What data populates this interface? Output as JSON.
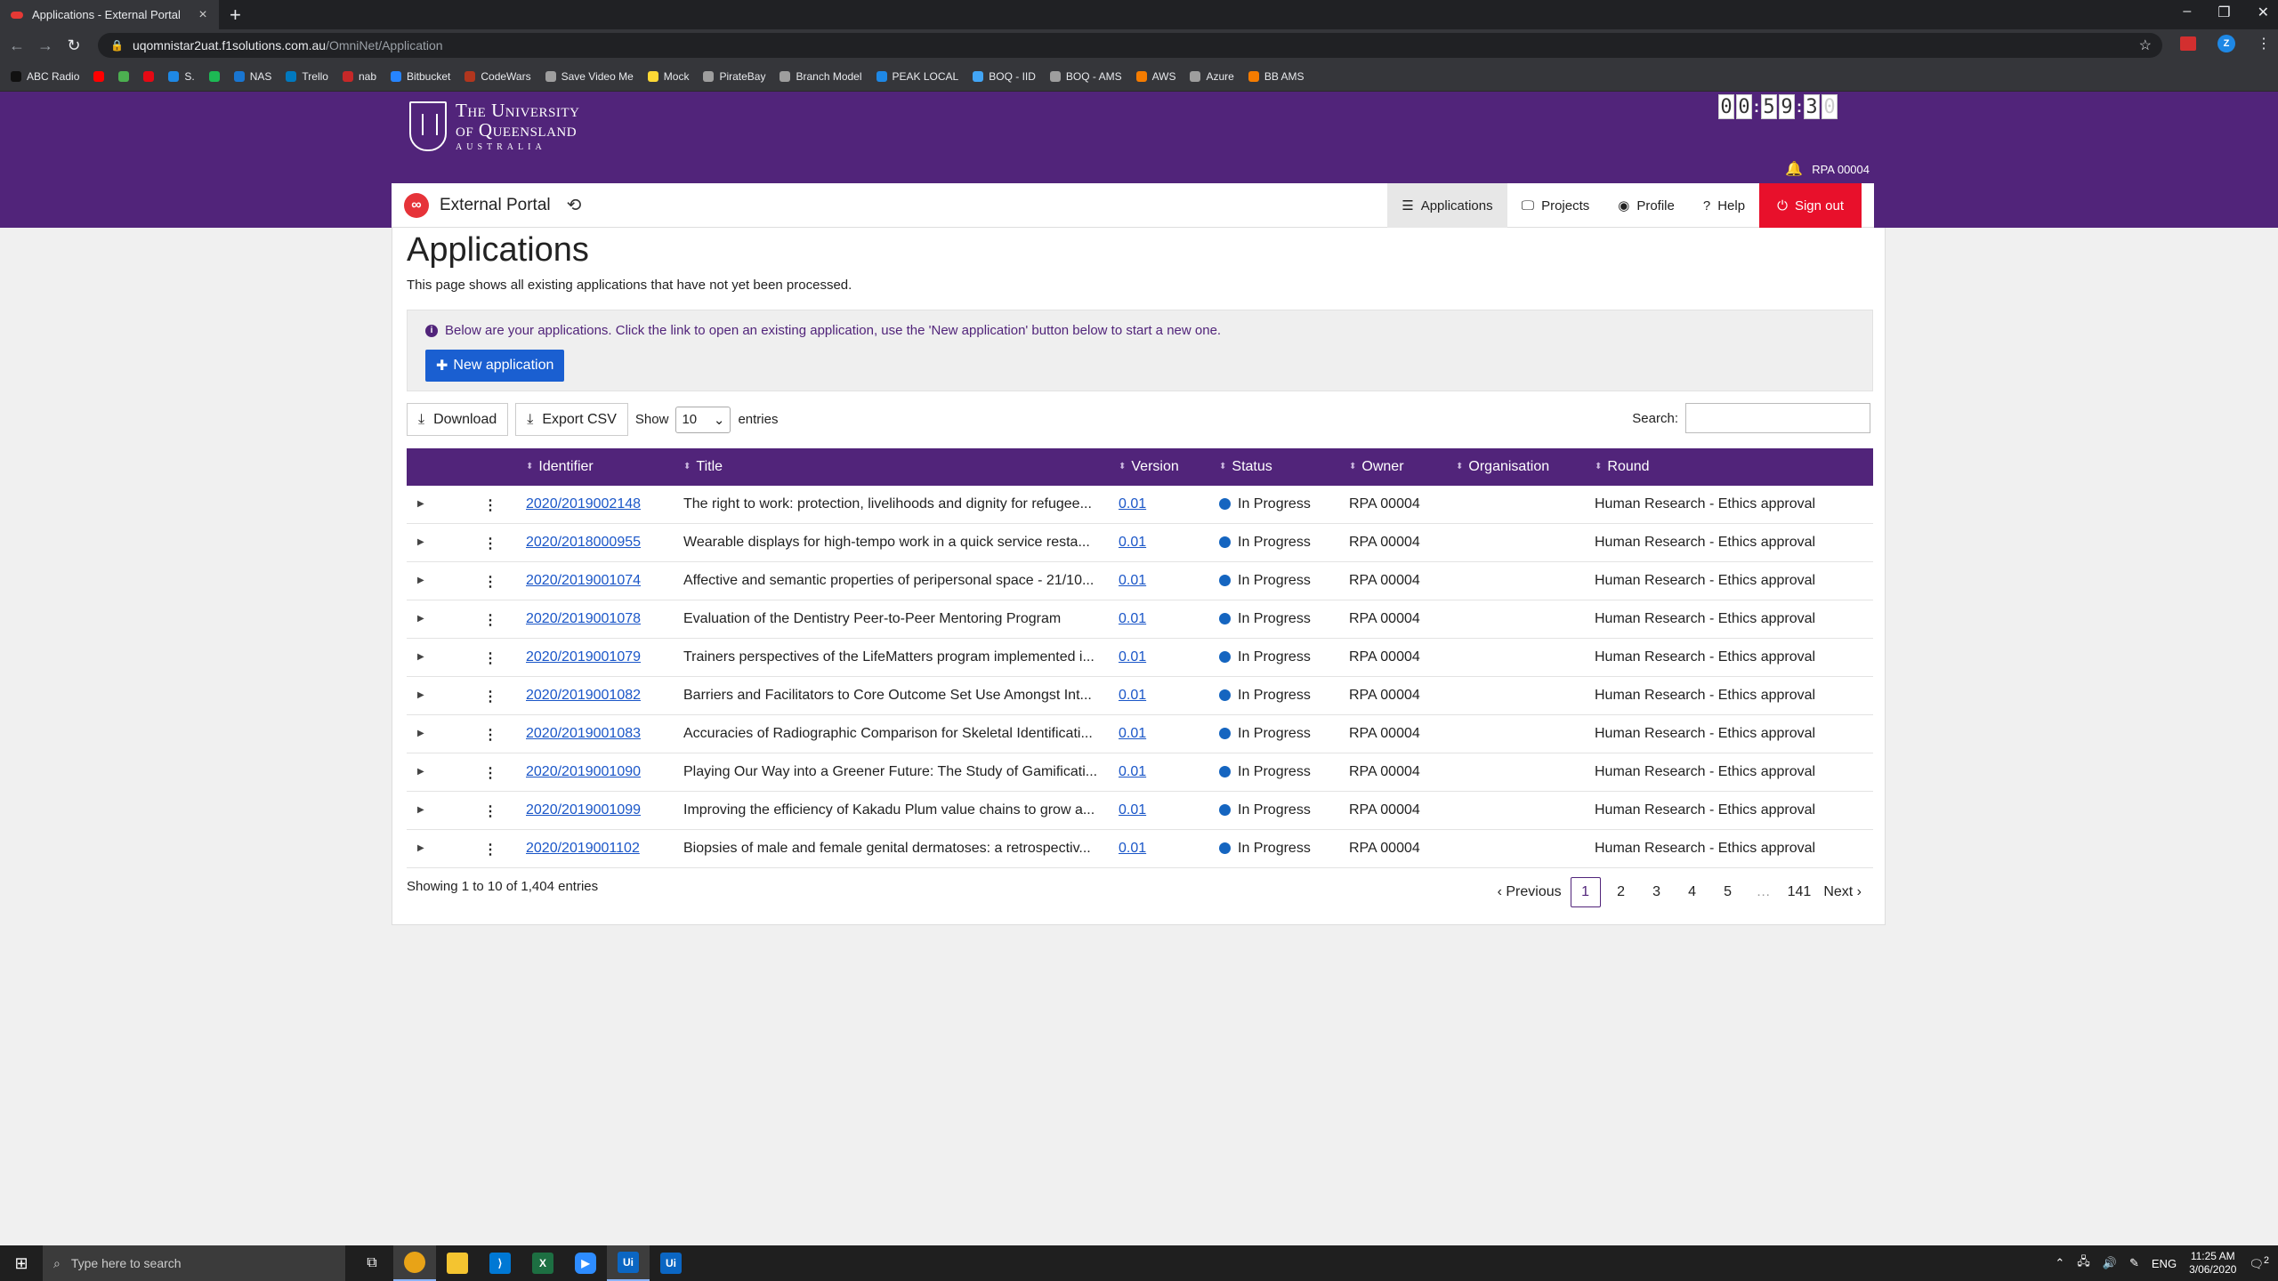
{
  "browser": {
    "tab_title": "Applications - External Portal",
    "url_domain": "uqomnistar2uat.f1solutions.com.au",
    "url_path": "/OmniNet/Application",
    "profile_initial": "Z",
    "bookmarks": [
      {
        "label": "ABC Radio",
        "color": "#111111"
      },
      {
        "label": "",
        "color": "#ff0000"
      },
      {
        "label": "",
        "color": "#4caf50"
      },
      {
        "label": "",
        "color": "#e50914"
      },
      {
        "label": "S.",
        "color": "#1e88e5"
      },
      {
        "label": "",
        "color": "#1db954"
      },
      {
        "label": "NAS",
        "color": "#1976d2"
      },
      {
        "label": "Trello",
        "color": "#0079bf"
      },
      {
        "label": "nab",
        "color": "#c62828"
      },
      {
        "label": "Bitbucket",
        "color": "#2684ff"
      },
      {
        "label": "CodeWars",
        "color": "#b1361e"
      },
      {
        "label": "Save Video Me",
        "color": "#9e9e9e"
      },
      {
        "label": "Mock",
        "color": "#fdd835"
      },
      {
        "label": "PirateBay",
        "color": "#9e9e9e"
      },
      {
        "label": "Branch Model",
        "color": "#9e9e9e"
      },
      {
        "label": "PEAK LOCAL",
        "color": "#1e88e5"
      },
      {
        "label": "BOQ - IID",
        "color": "#42a5f5"
      },
      {
        "label": "BOQ - AMS",
        "color": "#9e9e9e"
      },
      {
        "label": "AWS",
        "color": "#f57c00"
      },
      {
        "label": "Azure",
        "color": "#9e9e9e"
      },
      {
        "label": "BB AMS",
        "color": "#f57c00"
      }
    ]
  },
  "header": {
    "logo_line1": "The University",
    "logo_line2": "of Queensland",
    "logo_line3": "AUSTRALIA",
    "timer_digits": [
      "0",
      "0",
      "5",
      "9",
      "3",
      "0"
    ],
    "user": "RPA 00004",
    "brand": "External Portal",
    "nav": [
      {
        "label": "Applications",
        "icon": "list-icon"
      },
      {
        "label": "Projects",
        "icon": "monitor-icon"
      },
      {
        "label": "Profile",
        "icon": "user-circle-icon"
      },
      {
        "label": "Help",
        "icon": "question-icon"
      },
      {
        "label": "Sign out",
        "icon": "power-icon"
      }
    ]
  },
  "page": {
    "title": "Applications",
    "description": "This page shows all existing applications that have not yet been processed.",
    "info": "Below are your applications. Click the link to open an existing application, use the 'New application' button below to start a new one.",
    "new_button": "New application",
    "download": "Download",
    "export_csv": "Export CSV",
    "show_label": "Show",
    "show_value": "10",
    "entries_label": "entries",
    "search_label": "Search:",
    "search_value": ""
  },
  "table": {
    "headers": [
      "Identifier",
      "Title",
      "Version",
      "Status",
      "Owner",
      "Organisation",
      "Round"
    ],
    "rows": [
      {
        "id": "2020/2019002148",
        "title": "The right to work: protection, livelihoods and dignity for refugee...",
        "version": "0.01",
        "status": "In Progress",
        "owner": "RPA 00004",
        "org": "",
        "round": "Human Research - Ethics approval"
      },
      {
        "id": "2020/2018000955",
        "title": "Wearable displays for high-tempo work in a quick service resta...",
        "version": "0.01",
        "status": "In Progress",
        "owner": "RPA 00004",
        "org": "",
        "round": "Human Research - Ethics approval"
      },
      {
        "id": "2020/2019001074",
        "title": "Affective and semantic properties of peripersonal space - 21/10...",
        "version": "0.01",
        "status": "In Progress",
        "owner": "RPA 00004",
        "org": "",
        "round": "Human Research - Ethics approval"
      },
      {
        "id": "2020/2019001078",
        "title": "Evaluation of the Dentistry Peer-to-Peer Mentoring Program",
        "version": "0.01",
        "status": "In Progress",
        "owner": "RPA 00004",
        "org": "",
        "round": "Human Research - Ethics approval"
      },
      {
        "id": "2020/2019001079",
        "title": "Trainers perspectives of the LifeMatters program implemented i...",
        "version": "0.01",
        "status": "In Progress",
        "owner": "RPA 00004",
        "org": "",
        "round": "Human Research - Ethics approval"
      },
      {
        "id": "2020/2019001082",
        "title": "Barriers and Facilitators to Core Outcome Set Use Amongst Int...",
        "version": "0.01",
        "status": "In Progress",
        "owner": "RPA 00004",
        "org": "",
        "round": "Human Research - Ethics approval"
      },
      {
        "id": "2020/2019001083",
        "title": "Accuracies of Radiographic Comparison for Skeletal Identificati...",
        "version": "0.01",
        "status": "In Progress",
        "owner": "RPA 00004",
        "org": "",
        "round": "Human Research - Ethics approval"
      },
      {
        "id": "2020/2019001090",
        "title": "Playing Our Way into a Greener Future: The Study of Gamificati...",
        "version": "0.01",
        "status": "In Progress",
        "owner": "RPA 00004",
        "org": "",
        "round": "Human Research - Ethics approval"
      },
      {
        "id": "2020/2019001099",
        "title": "Improving the efficiency of Kakadu Plum value chains to grow a...",
        "version": "0.01",
        "status": "In Progress",
        "owner": "RPA 00004",
        "org": "",
        "round": "Human Research - Ethics approval"
      },
      {
        "id": "2020/2019001102",
        "title": "Biopsies of male and female genital dermatoses: a retrospectiv...",
        "version": "0.01",
        "status": "In Progress",
        "owner": "RPA 00004",
        "org": "",
        "round": "Human Research - Ethics approval"
      }
    ],
    "status_color": "#1565c0"
  },
  "pagination": {
    "info": "Showing 1 to 10 of 1,404 entries",
    "previous": "Previous",
    "next": "Next",
    "pages": [
      "1",
      "2",
      "3",
      "4",
      "5",
      "…",
      "141"
    ],
    "current": "1"
  },
  "taskbar": {
    "search_placeholder": "Type here to search",
    "lang": "ENG",
    "time": "11:25 AM",
    "date": "3/06/2020",
    "notification_count": "2"
  },
  "colors": {
    "brand_purple": "#51247a",
    "signout_red": "#e8102b",
    "primary_blue": "#1a5fd1"
  }
}
